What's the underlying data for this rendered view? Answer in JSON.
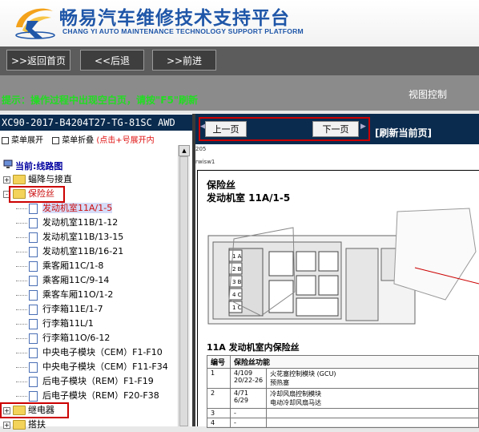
{
  "header": {
    "logo_icon": "cy-logo-icon",
    "title_cn": "畅易汽车维修技术支持平台",
    "title_en": "CHANG YI AUTO MAINTENANCE TECHNOLOGY SUPPORT PLATFORM"
  },
  "toolbar": {
    "home": ">>返回首页",
    "back": "<<后退",
    "forward": ">>前进"
  },
  "hint": "提示：操作过程中出现空白页，请按\"F5\"刷新",
  "view_control": "视图控制",
  "left": {
    "doc_id": "XC90-2017-B4204T27-TG-81SC AWD",
    "expand": "菜单展开",
    "collapse": "菜单折叠",
    "collapse_hint": "(点击+号展开内",
    "current_location": "当前:线路图",
    "tree": [
      {
        "label": "蝠降与接直",
        "kind": "folder",
        "toggle": "+"
      },
      {
        "label": "保险丝",
        "kind": "folder",
        "toggle": "-"
      },
      {
        "label": "发动机室11A/1-5",
        "kind": "page"
      },
      {
        "label": "发动机室11B/1-12",
        "kind": "page"
      },
      {
        "label": "发动机室11B/13-15",
        "kind": "page"
      },
      {
        "label": "发动机室11B/16-21",
        "kind": "page"
      },
      {
        "label": "乘客厢11C/1-8",
        "kind": "page"
      },
      {
        "label": "乘客厢11C/9-14",
        "kind": "page"
      },
      {
        "label": "乘客车厢11O/1-2",
        "kind": "page"
      },
      {
        "label": "行李箱11E/1-7",
        "kind": "page"
      },
      {
        "label": "行李箱11L/1",
        "kind": "page"
      },
      {
        "label": "行李箱11O/6-12",
        "kind": "page"
      },
      {
        "label": "中央电子模块（CEM）F1-F10",
        "kind": "page"
      },
      {
        "label": "中央电子模块（CEM）F11-F34",
        "kind": "page"
      },
      {
        "label": "后电子模块（REM）F1-F19",
        "kind": "page"
      },
      {
        "label": "后电子模块（REM）F20-F38",
        "kind": "page"
      },
      {
        "label": "继电器",
        "kind": "folder",
        "toggle": "+"
      },
      {
        "label": "搭扶",
        "kind": "folder",
        "toggle": "+"
      }
    ]
  },
  "right": {
    "prev": "上一页",
    "next": "下一页",
    "refresh": "[刷新当前页]",
    "small_num": "205",
    "small_txt": "rwisw1",
    "category": "保险丝",
    "diagram_title": "发动机室 11A/1-5",
    "fuse_labels": [
      "1 A",
      "2 B",
      "3 B",
      "4 C",
      "1 C"
    ],
    "table_title": "11A 发动机室内保险丝",
    "table_headers": [
      "编号",
      "保险丝功能"
    ],
    "rows": [
      {
        "no": "1",
        "code": "4/109\n20/22-26",
        "func": "火花塞控制模块 (GCU)\n预热塞"
      },
      {
        "no": "2",
        "code": "4/71\n6/29",
        "func": "冷却风扇控制模块\n电动冷却风扇马达"
      },
      {
        "no": "3",
        "code": "-",
        "func": ""
      },
      {
        "no": "4",
        "code": "-",
        "func": ""
      }
    ]
  },
  "colors": {
    "brand": "#1f56a8",
    "navy": "#0a2b4e",
    "hint_green": "#22dd22",
    "highlight_red": "#cc0000"
  }
}
